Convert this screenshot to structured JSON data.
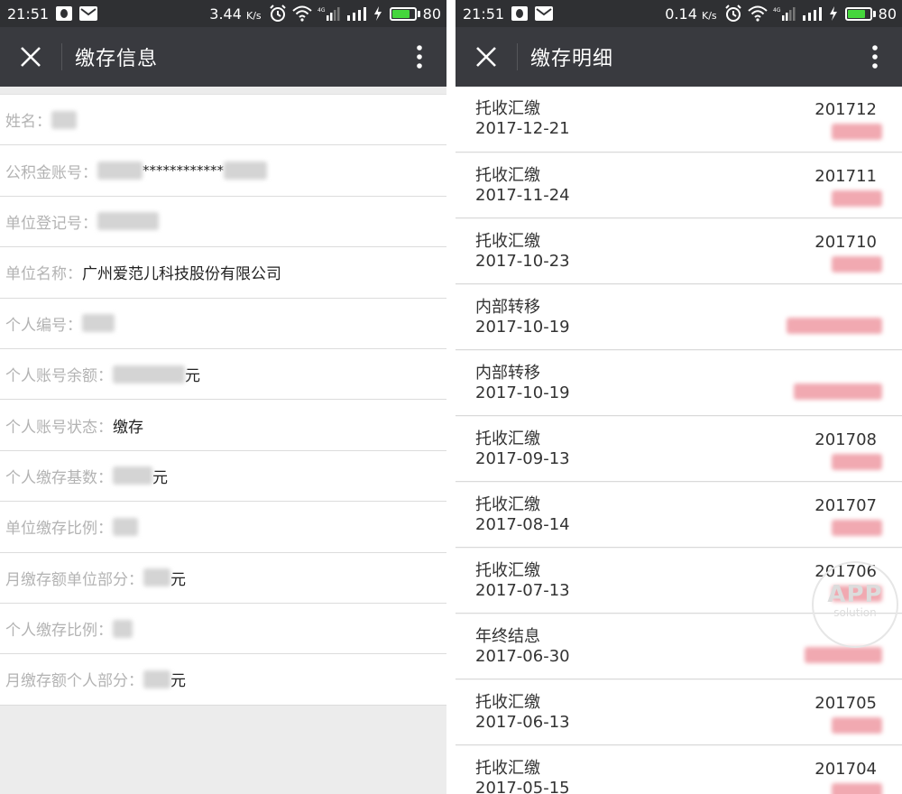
{
  "left_screen": {
    "status_bar": {
      "time": "21:51",
      "speed": "3.44",
      "speed_unit": "K/s",
      "battery": "80"
    },
    "title": "缴存信息",
    "rows": [
      {
        "label": "姓名：",
        "value": "",
        "unit": ""
      },
      {
        "label": "公积金账号：",
        "value": "************",
        "unit": ""
      },
      {
        "label": "单位登记号：",
        "value": "",
        "unit": ""
      },
      {
        "label": "单位名称：",
        "value": "广州爱范儿科技股份有限公司",
        "unit": ""
      },
      {
        "label": "个人编号：",
        "value": "",
        "unit": ""
      },
      {
        "label": "个人账号余额：",
        "value": "",
        "unit": "元"
      },
      {
        "label": "个人账号状态：",
        "value": "缴存",
        "unit": ""
      },
      {
        "label": "个人缴存基数：",
        "value": "",
        "unit": "元"
      },
      {
        "label": "单位缴存比例：",
        "value": "",
        "unit": ""
      },
      {
        "label": "月缴存额单位部分：",
        "value": "",
        "unit": "元"
      },
      {
        "label": "个人缴存比例：",
        "value": "",
        "unit": ""
      },
      {
        "label": "月缴存额个人部分：",
        "value": "",
        "unit": "元"
      }
    ]
  },
  "right_screen": {
    "status_bar": {
      "time": "21:51",
      "speed": "0.14",
      "speed_unit": "K/s",
      "battery": "80"
    },
    "title": "缴存明细",
    "records": [
      {
        "type": "托收汇缴",
        "date": "2017-12-21",
        "period": "201712"
      },
      {
        "type": "托收汇缴",
        "date": "2017-11-24",
        "period": "201711"
      },
      {
        "type": "托收汇缴",
        "date": "2017-10-23",
        "period": "201710"
      },
      {
        "type": "内部转移",
        "date": "2017-10-19",
        "period": ""
      },
      {
        "type": "内部转移",
        "date": "2017-10-19",
        "period": ""
      },
      {
        "type": "托收汇缴",
        "date": "2017-09-13",
        "period": "201708"
      },
      {
        "type": "托收汇缴",
        "date": "2017-08-14",
        "period": "201707"
      },
      {
        "type": "托收汇缴",
        "date": "2017-07-13",
        "period": "201706"
      },
      {
        "type": "年终结息",
        "date": "2017-06-30",
        "period": ""
      },
      {
        "type": "托收汇缴",
        "date": "2017-06-13",
        "period": "201705"
      },
      {
        "type": "托收汇缴",
        "date": "2017-05-15",
        "period": "201704"
      }
    ],
    "watermark": {
      "title": "APP",
      "subtitle": "solution"
    }
  },
  "colors": {
    "status_bar": "#2f3033",
    "app_bar": "#393a3f",
    "label_gray": "#b3b3b3",
    "battery_green": "#45d63c",
    "amount_pink": "#f1a9b1"
  },
  "icons": [
    "close-icon",
    "more-vert-icon",
    "alarm-icon",
    "wifi-icon",
    "signal-icon",
    "charging-icon",
    "battery-icon",
    "qq-icon",
    "mail-icon"
  ]
}
